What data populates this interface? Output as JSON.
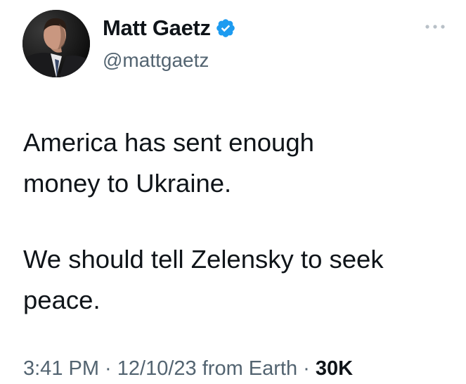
{
  "author": {
    "name": "Matt Gaetz",
    "handle": "@mattgaetz",
    "verified": true,
    "verified_color": "#1d9bf0"
  },
  "icons": {
    "verified": "verified-badge-icon",
    "more": "more-options-icon"
  },
  "tweet": {
    "paragraphs": [
      "America has sent enough money to Ukraine.",
      "We should tell Zelensky to seek peace."
    ],
    "line_breaks": [
      [
        "America has sent enough",
        "money to Ukraine."
      ],
      [
        "We should tell Zelensky to seek",
        "peace."
      ]
    ]
  },
  "meta": {
    "time": "3:41 PM",
    "separator": " · ",
    "date": "12/10/23",
    "source": "from Earth",
    "views": "30K"
  }
}
